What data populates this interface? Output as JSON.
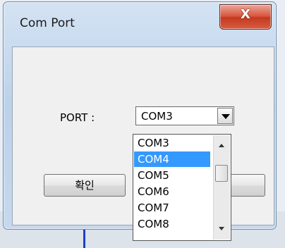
{
  "window": {
    "title": "Com Port",
    "close_glyph": "X"
  },
  "form": {
    "port_label": "PORT :",
    "selected_port": "COM3",
    "ok_label": "확인"
  },
  "dropdown": {
    "items": [
      "COM3",
      "COM4",
      "COM5",
      "COM6",
      "COM7",
      "COM8"
    ],
    "highlighted": "COM4"
  },
  "colors": {
    "highlight": "#3399ff",
    "close_button": "#c23a20"
  },
  "icons": {
    "close": "close-icon",
    "combo_arrow": "chevron-down-icon",
    "scroll_up": "scroll-up-icon",
    "scroll_down": "scroll-down-icon"
  }
}
